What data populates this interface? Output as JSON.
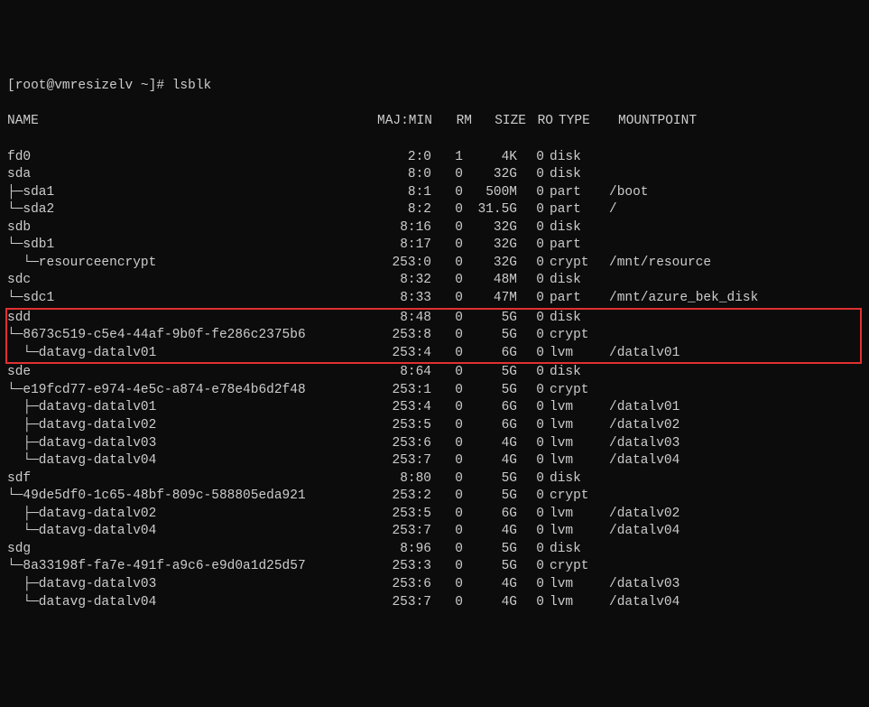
{
  "prompt": "[root@vmresizelv ~]# lsblk",
  "headers": {
    "name": "NAME",
    "majmin": "MAJ:MIN",
    "rm": "RM",
    "size": "SIZE",
    "ro": "RO",
    "type": "TYPE",
    "mount": "MOUNTPOINT"
  },
  "rows": [
    {
      "name": "fd0",
      "majmin": "2:0",
      "rm": "1",
      "size": "4K",
      "ro": "0",
      "type": "disk",
      "mount": "",
      "hl": false
    },
    {
      "name": "sda",
      "majmin": "8:0",
      "rm": "0",
      "size": "32G",
      "ro": "0",
      "type": "disk",
      "mount": "",
      "hl": false
    },
    {
      "name": "├─sda1",
      "majmin": "8:1",
      "rm": "0",
      "size": "500M",
      "ro": "0",
      "type": "part",
      "mount": "/boot",
      "hl": false
    },
    {
      "name": "└─sda2",
      "majmin": "8:2",
      "rm": "0",
      "size": "31.5G",
      "ro": "0",
      "type": "part",
      "mount": "/",
      "hl": false
    },
    {
      "name": "sdb",
      "majmin": "8:16",
      "rm": "0",
      "size": "32G",
      "ro": "0",
      "type": "disk",
      "mount": "",
      "hl": false
    },
    {
      "name": "└─sdb1",
      "majmin": "8:17",
      "rm": "0",
      "size": "32G",
      "ro": "0",
      "type": "part",
      "mount": "",
      "hl": false
    },
    {
      "name": "  └─resourceencrypt",
      "majmin": "253:0",
      "rm": "0",
      "size": "32G",
      "ro": "0",
      "type": "crypt",
      "mount": "/mnt/resource",
      "hl": false
    },
    {
      "name": "sdc",
      "majmin": "8:32",
      "rm": "0",
      "size": "48M",
      "ro": "0",
      "type": "disk",
      "mount": "",
      "hl": false
    },
    {
      "name": "└─sdc1",
      "majmin": "8:33",
      "rm": "0",
      "size": "47M",
      "ro": "0",
      "type": "part",
      "mount": "/mnt/azure_bek_disk",
      "hl": false
    },
    {
      "name": "sdd",
      "majmin": "8:48",
      "rm": "0",
      "size": "5G",
      "ro": "0",
      "type": "disk",
      "mount": "",
      "hl": true
    },
    {
      "name": "└─8673c519-c5e4-44af-9b0f-fe286c2375b6",
      "majmin": "253:8",
      "rm": "0",
      "size": "5G",
      "ro": "0",
      "type": "crypt",
      "mount": "",
      "hl": true
    },
    {
      "name": "  └─datavg-datalv01",
      "majmin": "253:4",
      "rm": "0",
      "size": "6G",
      "ro": "0",
      "type": "lvm",
      "mount": "/datalv01",
      "hl": true
    },
    {
      "name": "sde",
      "majmin": "8:64",
      "rm": "0",
      "size": "5G",
      "ro": "0",
      "type": "disk",
      "mount": "",
      "hl": false
    },
    {
      "name": "└─e19fcd77-e974-4e5c-a874-e78e4b6d2f48",
      "majmin": "253:1",
      "rm": "0",
      "size": "5G",
      "ro": "0",
      "type": "crypt",
      "mount": "",
      "hl": false
    },
    {
      "name": "  ├─datavg-datalv01",
      "majmin": "253:4",
      "rm": "0",
      "size": "6G",
      "ro": "0",
      "type": "lvm",
      "mount": "/datalv01",
      "hl": false
    },
    {
      "name": "  ├─datavg-datalv02",
      "majmin": "253:5",
      "rm": "0",
      "size": "6G",
      "ro": "0",
      "type": "lvm",
      "mount": "/datalv02",
      "hl": false
    },
    {
      "name": "  ├─datavg-datalv03",
      "majmin": "253:6",
      "rm": "0",
      "size": "4G",
      "ro": "0",
      "type": "lvm",
      "mount": "/datalv03",
      "hl": false
    },
    {
      "name": "  └─datavg-datalv04",
      "majmin": "253:7",
      "rm": "0",
      "size": "4G",
      "ro": "0",
      "type": "lvm",
      "mount": "/datalv04",
      "hl": false
    },
    {
      "name": "sdf",
      "majmin": "8:80",
      "rm": "0",
      "size": "5G",
      "ro": "0",
      "type": "disk",
      "mount": "",
      "hl": false
    },
    {
      "name": "└─49de5df0-1c65-48bf-809c-588805eda921",
      "majmin": "253:2",
      "rm": "0",
      "size": "5G",
      "ro": "0",
      "type": "crypt",
      "mount": "",
      "hl": false
    },
    {
      "name": "  ├─datavg-datalv02",
      "majmin": "253:5",
      "rm": "0",
      "size": "6G",
      "ro": "0",
      "type": "lvm",
      "mount": "/datalv02",
      "hl": false
    },
    {
      "name": "  └─datavg-datalv04",
      "majmin": "253:7",
      "rm": "0",
      "size": "4G",
      "ro": "0",
      "type": "lvm",
      "mount": "/datalv04",
      "hl": false
    },
    {
      "name": "sdg",
      "majmin": "8:96",
      "rm": "0",
      "size": "5G",
      "ro": "0",
      "type": "disk",
      "mount": "",
      "hl": false
    },
    {
      "name": "└─8a33198f-fa7e-491f-a9c6-e9d0a1d25d57",
      "majmin": "253:3",
      "rm": "0",
      "size": "5G",
      "ro": "0",
      "type": "crypt",
      "mount": "",
      "hl": false
    },
    {
      "name": "  ├─datavg-datalv03",
      "majmin": "253:6",
      "rm": "0",
      "size": "4G",
      "ro": "0",
      "type": "lvm",
      "mount": "/datalv03",
      "hl": false
    },
    {
      "name": "  └─datavg-datalv04",
      "majmin": "253:7",
      "rm": "0",
      "size": "4G",
      "ro": "0",
      "type": "lvm",
      "mount": "/datalv04",
      "hl": false
    }
  ]
}
